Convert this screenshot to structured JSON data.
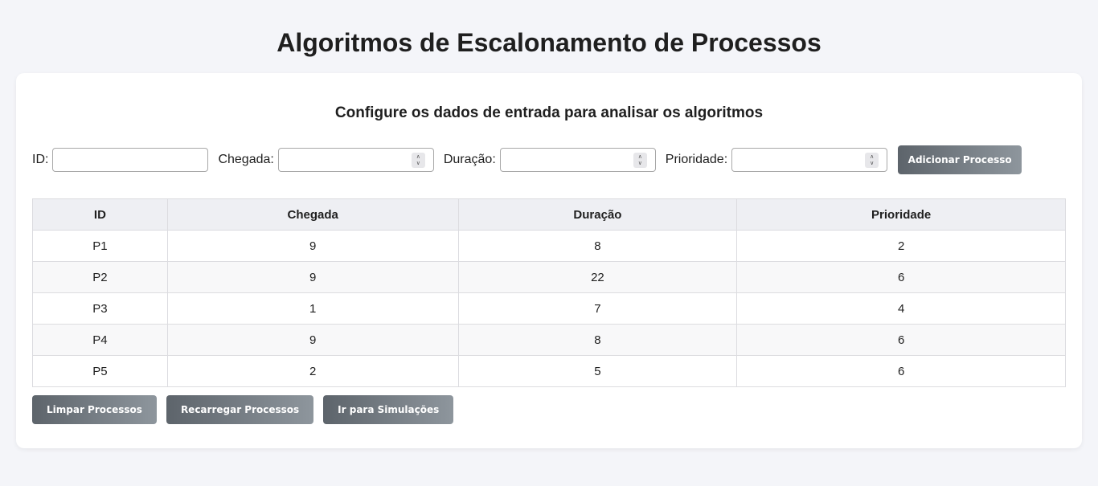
{
  "page": {
    "title": "Algoritmos de Escalonamento de Processos"
  },
  "form": {
    "subtitle": "Configure os dados de entrada para analisar os algoritmos",
    "id_label": "ID:",
    "id_value": "",
    "arrival_label": "Chegada:",
    "arrival_value": "",
    "duration_label": "Duração:",
    "duration_value": "",
    "priority_label": "Prioridade:",
    "priority_value": "",
    "add_button": "Adicionar Processo"
  },
  "table": {
    "headers": [
      "ID",
      "Chegada",
      "Duração",
      "Prioridade"
    ],
    "rows": [
      [
        "P1",
        "9",
        "8",
        "2"
      ],
      [
        "P2",
        "9",
        "22",
        "6"
      ],
      [
        "P3",
        "1",
        "7",
        "4"
      ],
      [
        "P4",
        "9",
        "8",
        "6"
      ],
      [
        "P5",
        "2",
        "5",
        "6"
      ]
    ]
  },
  "actions": {
    "clear": "Limpar Processos",
    "reload": "Recarregar Processos",
    "simulate": "Ir para Simulações"
  },
  "colors": {
    "background": "#f4f5f9",
    "card": "#ffffff",
    "button_gradient_start": "#5d646b",
    "button_gradient_end": "#8e969d",
    "table_header": "#eeeff3"
  }
}
